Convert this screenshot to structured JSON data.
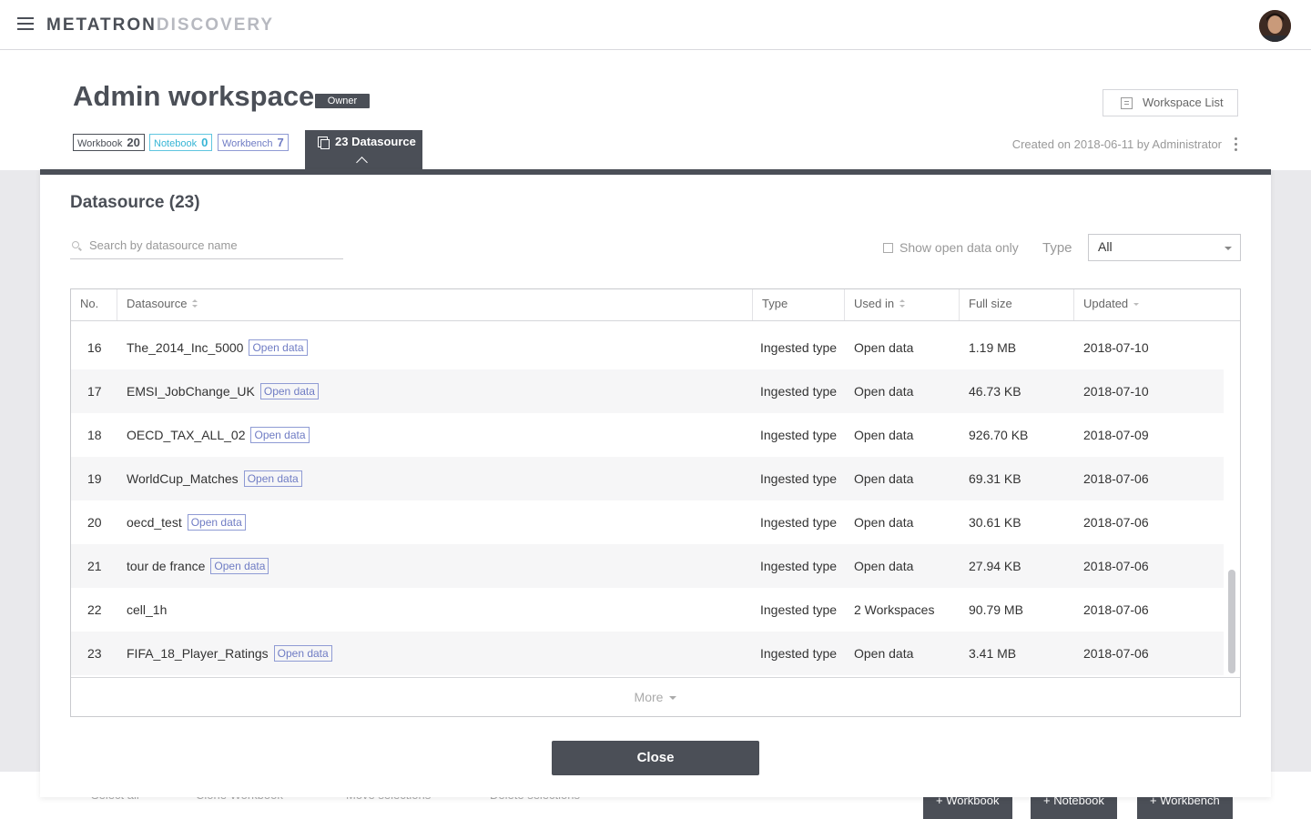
{
  "app": {
    "logo_part1": "METATRON",
    "logo_part2": "DISCOVERY"
  },
  "workspace": {
    "title": "Admin workspace",
    "owner_badge": "Owner",
    "list_button": "Workspace List",
    "created": "Created on 2018-06-11 by Administrator",
    "counters": {
      "workbook_label": "Workbook",
      "workbook_count": "20",
      "notebook_label": "Notebook",
      "notebook_count": "0",
      "workbench_label": "Workbench",
      "workbench_count": "7"
    },
    "datasource_tab": "23 Datasource"
  },
  "background_footer": {
    "select_all": "Select all",
    "clone": "Clone Workbook",
    "move": "Move selections",
    "delete": "Delete selections",
    "btn_workbook": "+ Workbook",
    "btn_notebook": "+ Notebook",
    "btn_workbench": "+ Workbench"
  },
  "modal": {
    "title": "Datasource (23)",
    "search_placeholder": "Search by datasource name",
    "open_data_filter": "Show open data only",
    "type_label": "Type",
    "type_selected": "All",
    "columns": {
      "no": "No.",
      "datasource": "Datasource",
      "type": "Type",
      "used_in": "Used in",
      "full_size": "Full size",
      "updated": "Updated"
    },
    "open_data_badge": "Open data",
    "rows": [
      {
        "no": "16",
        "name": "The_2014_Inc_5000",
        "open": true,
        "type": "Ingested type",
        "used": "Open data",
        "size": "1.19 MB",
        "updated": "2018-07-10"
      },
      {
        "no": "17",
        "name": "EMSI_JobChange_UK",
        "open": true,
        "type": "Ingested type",
        "used": "Open data",
        "size": "46.73 KB",
        "updated": "2018-07-10"
      },
      {
        "no": "18",
        "name": "OECD_TAX_ALL_02",
        "open": true,
        "type": "Ingested type",
        "used": "Open data",
        "size": "926.70 KB",
        "updated": "2018-07-09"
      },
      {
        "no": "19",
        "name": "WorldCup_Matches",
        "open": true,
        "type": "Ingested type",
        "used": "Open data",
        "size": "69.31 KB",
        "updated": "2018-07-06"
      },
      {
        "no": "20",
        "name": "oecd_test",
        "open": true,
        "type": "Ingested type",
        "used": "Open data",
        "size": "30.61 KB",
        "updated": "2018-07-06"
      },
      {
        "no": "21",
        "name": "tour de france",
        "open": true,
        "type": "Ingested type",
        "used": "Open data",
        "size": "27.94 KB",
        "updated": "2018-07-06"
      },
      {
        "no": "22",
        "name": "cell_1h",
        "open": false,
        "type": "Ingested type",
        "used": "2 Workspaces",
        "size": "90.79 MB",
        "updated": "2018-07-06"
      },
      {
        "no": "23",
        "name": "FIFA_18_Player_Ratings",
        "open": true,
        "type": "Ingested type",
        "used": "Open data",
        "size": "3.41 MB",
        "updated": "2018-07-06"
      }
    ],
    "more": "More",
    "close": "Close"
  }
}
